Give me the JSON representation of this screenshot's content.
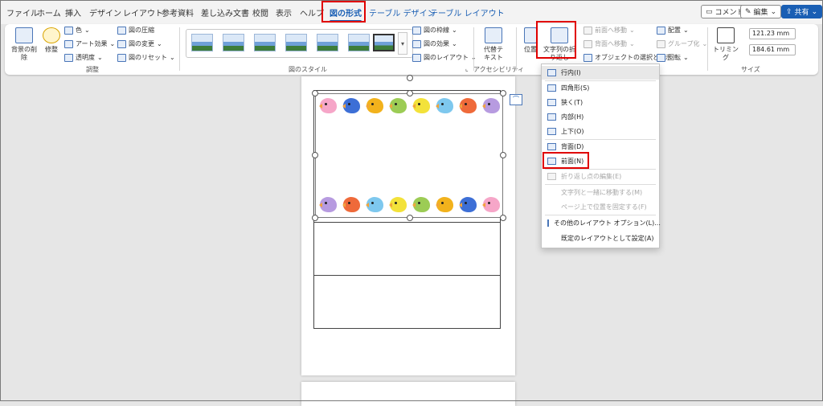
{
  "tabs": [
    {
      "label": "ファイル"
    },
    {
      "label": "ホーム"
    },
    {
      "label": "挿入"
    },
    {
      "label": "デザイン"
    },
    {
      "label": "レイアウト"
    },
    {
      "label": "参考資料"
    },
    {
      "label": "差し込み文書"
    },
    {
      "label": "校閲"
    },
    {
      "label": "表示"
    },
    {
      "label": "ヘルプ"
    },
    {
      "label": "図の形式"
    },
    {
      "label": "テーブル デザイン"
    },
    {
      "label": "テーブル レイアウト"
    }
  ],
  "title_buttons": {
    "comment": "コメント",
    "edit": "編集",
    "share": "共有"
  },
  "ribbon": {
    "remove_bg": "背景の削除",
    "corrections": "修整",
    "color": "色",
    "artistic": "アート効果",
    "transparency": "透明度",
    "compress": "図の圧縮",
    "change": "図の変更",
    "reset": "図のリセット",
    "group_adjust": "調整",
    "group_styles": "図のスタイル",
    "border": "図の枠線",
    "effects": "図の効果",
    "layout": "図のレイアウト",
    "alt_text": "代替テキスト",
    "group_access": "アクセシビリティ",
    "position": "位置",
    "wrap_text": "文字列の折り返し",
    "bring_forward": "前面へ移動",
    "send_backward": "背面へ移動",
    "selection_pane": "オブジェクトの選択と表示",
    "align": "配置",
    "group": "グループ化",
    "rotate": "回転",
    "crop": "トリミング",
    "height": "121.23 mm",
    "width": "184.61 mm",
    "group_size": "サイズ"
  },
  "menu": {
    "items": [
      {
        "label": "行内(I)",
        "enabled": true
      },
      {
        "label": "四角形(S)",
        "enabled": true
      },
      {
        "label": "狭く(T)",
        "enabled": true
      },
      {
        "label": "内部(H)",
        "enabled": true
      },
      {
        "label": "上下(O)",
        "enabled": true
      },
      {
        "label": "背面(D)",
        "enabled": true
      },
      {
        "label": "前面(N)",
        "enabled": true
      },
      {
        "label": "折り返し点の編集(E)",
        "enabled": false
      },
      {
        "label": "文字列と一緒に移動する(M)",
        "enabled": false
      },
      {
        "label": "ページ上で位置を固定する(F)",
        "enabled": false
      },
      {
        "label": "その他のレイアウト オプション(L)...",
        "enabled": true
      },
      {
        "label": "既定のレイアウトとして設定(A)",
        "enabled": true
      }
    ]
  },
  "colors": {
    "accent": "#1a5fb4",
    "highlight": "#e00000"
  }
}
